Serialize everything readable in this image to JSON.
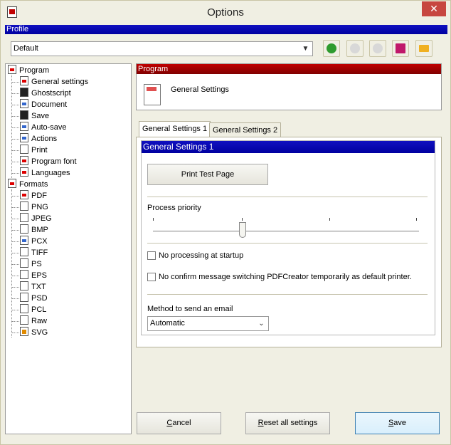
{
  "window": {
    "title": "Options",
    "close_glyph": "✕"
  },
  "profile": {
    "header": "Profile",
    "selected": "Default",
    "toolbar_icons": [
      "add-profile-icon",
      "rename-profile-icon",
      "delete-profile-icon",
      "save-profile-icon",
      "open-profile-icon"
    ]
  },
  "tree": {
    "program": {
      "label": "Program",
      "items": [
        {
          "label": "General settings",
          "icon": "general-settings-icon"
        },
        {
          "label": "Ghostscript",
          "icon": "ghostscript-icon"
        },
        {
          "label": "Document",
          "icon": "document-icon"
        },
        {
          "label": "Save",
          "icon": "save-icon"
        },
        {
          "label": "Auto-save",
          "icon": "auto-save-icon"
        },
        {
          "label": "Actions",
          "icon": "actions-icon"
        },
        {
          "label": "Print",
          "icon": "print-icon"
        },
        {
          "label": "Program font",
          "icon": "program-font-icon"
        },
        {
          "label": "Languages",
          "icon": "languages-icon"
        }
      ]
    },
    "formats": {
      "label": "Formats",
      "items": [
        {
          "label": "PDF",
          "icon": "pdf-icon"
        },
        {
          "label": "PNG",
          "icon": "png-icon"
        },
        {
          "label": "JPEG",
          "icon": "jpeg-icon"
        },
        {
          "label": "BMP",
          "icon": "bmp-icon"
        },
        {
          "label": "PCX",
          "icon": "pcx-icon"
        },
        {
          "label": "TIFF",
          "icon": "tiff-icon"
        },
        {
          "label": "PS",
          "icon": "ps-icon"
        },
        {
          "label": "EPS",
          "icon": "eps-icon"
        },
        {
          "label": "TXT",
          "icon": "txt-icon"
        },
        {
          "label": "PSD",
          "icon": "psd-icon"
        },
        {
          "label": "PCL",
          "icon": "pcl-icon"
        },
        {
          "label": "Raw",
          "icon": "raw-icon"
        },
        {
          "label": "SVG",
          "icon": "svg-icon"
        }
      ]
    }
  },
  "panel": {
    "header": "Program",
    "title": "General Settings"
  },
  "tabs": [
    {
      "label": "General Settings 1",
      "active": true
    },
    {
      "label": "General Settings 2",
      "active": false
    }
  ],
  "general1": {
    "header": "General Settings 1",
    "print_test_page": "Print Test Page",
    "process_priority_label": "Process priority",
    "process_priority_level": 0.33,
    "no_processing_label": "No processing at startup",
    "no_processing_checked": false,
    "no_confirm_label": "No confirm message switching PDFCreator temporarily as default printer.",
    "no_confirm_checked": false,
    "email_method_label": "Method to send an email",
    "email_method_value": "Automatic"
  },
  "footer": {
    "cancel_mnemonic": "C",
    "cancel_rest": "ancel",
    "reset_mnemonic": "R",
    "reset_rest": "eset all settings",
    "save_mnemonic": "S",
    "save_rest": "ave"
  },
  "colors": {
    "profile_bar": "#0000a0",
    "program_bar": "#a00000",
    "window_bg": "#f0efe3",
    "close_button": "#c74640"
  }
}
